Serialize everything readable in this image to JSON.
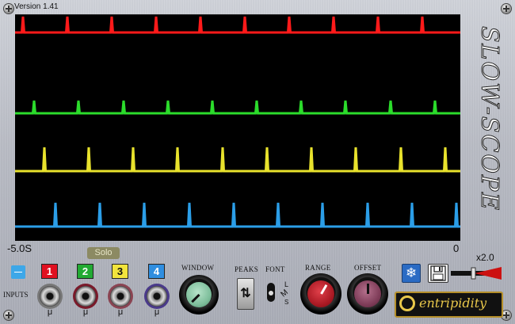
{
  "version": "Version 1.41",
  "title": "SLOW-SCOPE",
  "time_left": "-5.0S",
  "time_right": "0",
  "solo_label": "Solo",
  "inputs_label": "INPUTS",
  "inputs": [
    {
      "num": "1",
      "color": "#e01020",
      "text_color": "#ffffff",
      "ring": "#777777",
      "mu": "μ"
    },
    {
      "num": "2",
      "color": "#22aa33",
      "text_color": "#ffffff",
      "ring": "#7a1a2a",
      "mu": "μ"
    },
    {
      "num": "3",
      "color": "#f2e43c",
      "text_color": "#111111",
      "ring": "#8a4452",
      "mu": "μ"
    },
    {
      "num": "4",
      "color": "#2f8ee0",
      "text_color": "#ffffff",
      "ring": "#4a3a8a",
      "mu": "μ"
    }
  ],
  "window_label": "WINDOW",
  "peaks_label": "PEAKS",
  "font_label": "FONT",
  "font_options": {
    "l": "L",
    "m": "M",
    "s": "S"
  },
  "range_label": "RANGE",
  "offset_label": "OFFSET",
  "zoom_label": "x2.0",
  "logo_text": "entripidity",
  "traces": [
    {
      "name": "trace-1",
      "color": "#ff1a1a",
      "baseline": 22,
      "peaks": [
        10,
        66,
        122,
        178,
        234,
        290,
        346,
        402,
        458,
        514
      ],
      "amplitude": -20
    },
    {
      "name": "trace-2",
      "color": "#2bdc2b",
      "baseline": 124,
      "peaks": [
        24,
        80,
        137,
        193,
        249,
        305,
        361,
        417,
        474,
        530
      ],
      "amplitude": -16
    },
    {
      "name": "trace-3",
      "color": "#e8e22c",
      "baseline": 197,
      "peaks": [
        37,
        93,
        149,
        205,
        262,
        318,
        374,
        430,
        487,
        543
      ],
      "amplitude": -30
    },
    {
      "name": "trace-4",
      "color": "#2b9ee8",
      "baseline": 267,
      "peaks": [
        51,
        107,
        163,
        220,
        276,
        332,
        388,
        445,
        501,
        557
      ],
      "amplitude": -30
    }
  ]
}
